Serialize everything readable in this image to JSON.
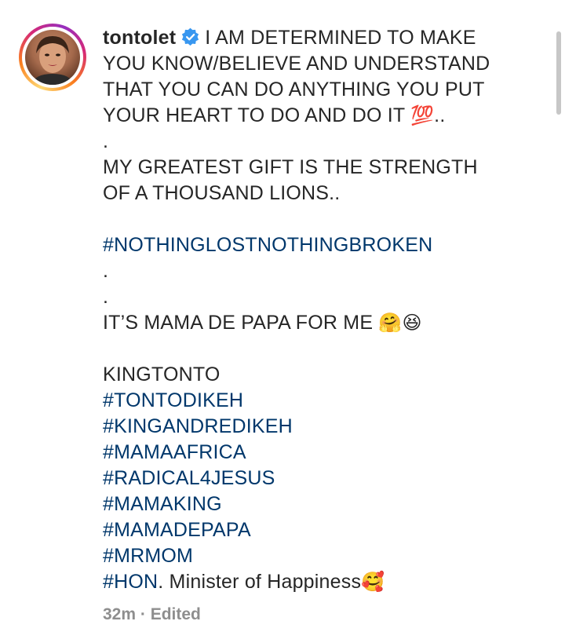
{
  "post": {
    "username": "tontolet",
    "caption_lines": [
      "I AM DETERMINED TO MAKE",
      "YOU KNOW/BELIEVE AND UNDERSTAND",
      "THAT YOU CAN DO ANYTHING YOU PUT",
      "YOUR HEART TO DO AND DO IT",
      "💯",
      "..",
      ".",
      "MY GREATEST GIFT IS THE STRENGTH",
      "OF A THOUSAND LIONS..",
      "#NOTHINGLOSTNOTHINGBROKEN",
      ".",
      ".",
      "IT’S MAMA DE PAPA FOR ME",
      "🤗😆",
      "KINGTONTO",
      "#TONTODIKEH",
      "#KINGANDREDIKEH",
      "#MAMAAFRICA",
      "#RADICAL4JESUS",
      "#MAMAKING",
      "#MAMADEPAPA",
      "#MRMOM",
      "#HON",
      ". Minister of Happiness",
      "🥰"
    ],
    "time": "32m",
    "separator": "·",
    "edited": "Edited"
  },
  "colors": {
    "text": "#262626",
    "hashtag": "#00376b",
    "meta": "#8e8e8e",
    "verified": "#3897f0"
  },
  "icons": {
    "verified": "verified-badge-icon"
  }
}
